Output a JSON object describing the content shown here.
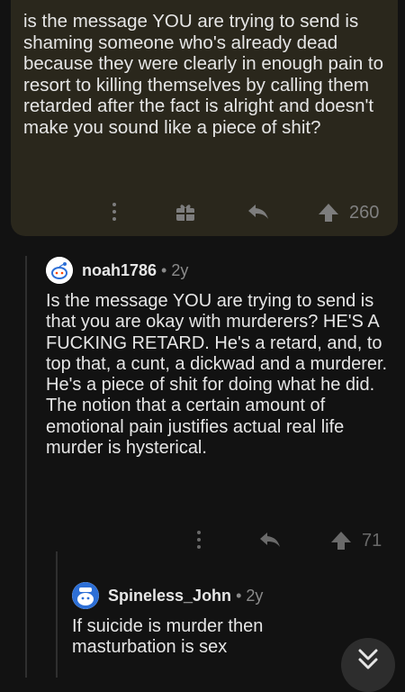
{
  "parent_comment": {
    "text": "is the message YOU are trying to send is shaming someone who's already dead because they were clearly in enough pain to resort to killing themselves by calling them retarded after the fact is alright and doesn't make you sound like a piece of shit?",
    "upvotes": "260",
    "icons": [
      "more-icon",
      "award-icon",
      "reply-icon",
      "upvote-icon"
    ]
  },
  "reply_1": {
    "username": "noah1786",
    "separator": "•",
    "age": "2y",
    "text": "Is the message YOU are trying to send is that you are okay with murderers? HE'S A FUCKING RETARD. He's a retard, and, to top that, a cunt, a dickwad and a murderer. He's a piece of shit for doing what he did. The notion that a certain amount of emotional pain justifies actual real life murder is hysterical.",
    "upvotes": "71",
    "icons": [
      "more-icon",
      "reply-icon",
      "upvote-icon"
    ]
  },
  "reply_2": {
    "username": "Spineless_John",
    "separator": "•",
    "age": "2y",
    "text": "If suicide is murder then masturbation is sex"
  },
  "scroll_button": {
    "icon": "double-chevron-down-icon"
  }
}
